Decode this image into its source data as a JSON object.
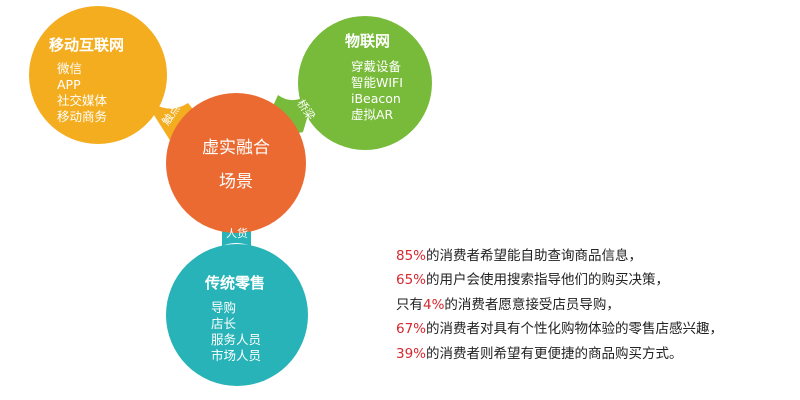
{
  "colors": {
    "mobile": "#f3ad1f",
    "iot": "#78bb3a",
    "center": "#ea6a32",
    "retail": "#27b3b7",
    "highlight": "#d6282f",
    "text": "#222222"
  },
  "nodes": {
    "mobile": {
      "title": "移动互联网",
      "items": [
        "微信",
        "APP",
        "社交媒体",
        "移动商务"
      ]
    },
    "iot": {
      "title": "物联网",
      "items": [
        "穿戴设备",
        "智能WIFI",
        "iBeacon",
        "虚拟AR"
      ]
    },
    "center": {
      "line1": "虚实融合",
      "line2": "场景"
    },
    "retail": {
      "title": "传统零售",
      "items": [
        "导购",
        "店长",
        "服务人员",
        "市场人员"
      ]
    }
  },
  "connectors": {
    "mobile": "触点",
    "iot": "桥梁",
    "retail": "人货"
  },
  "stats": [
    {
      "pct": "85%",
      "text": "的消费者希望能自助查询商品信息，"
    },
    {
      "pct": "65%",
      "text": "的用户会使用搜索指导他们的购买决策，"
    },
    {
      "prefix": "只有",
      "pct": "4%",
      "text": "的消费者愿意接受店员导购，"
    },
    {
      "pct": "67%",
      "text": "的消费者对具有个性化购物体验的零售店感兴趣，"
    },
    {
      "pct": "39%",
      "text": "的消费者则希望有更便捷的商品购买方式。"
    }
  ]
}
